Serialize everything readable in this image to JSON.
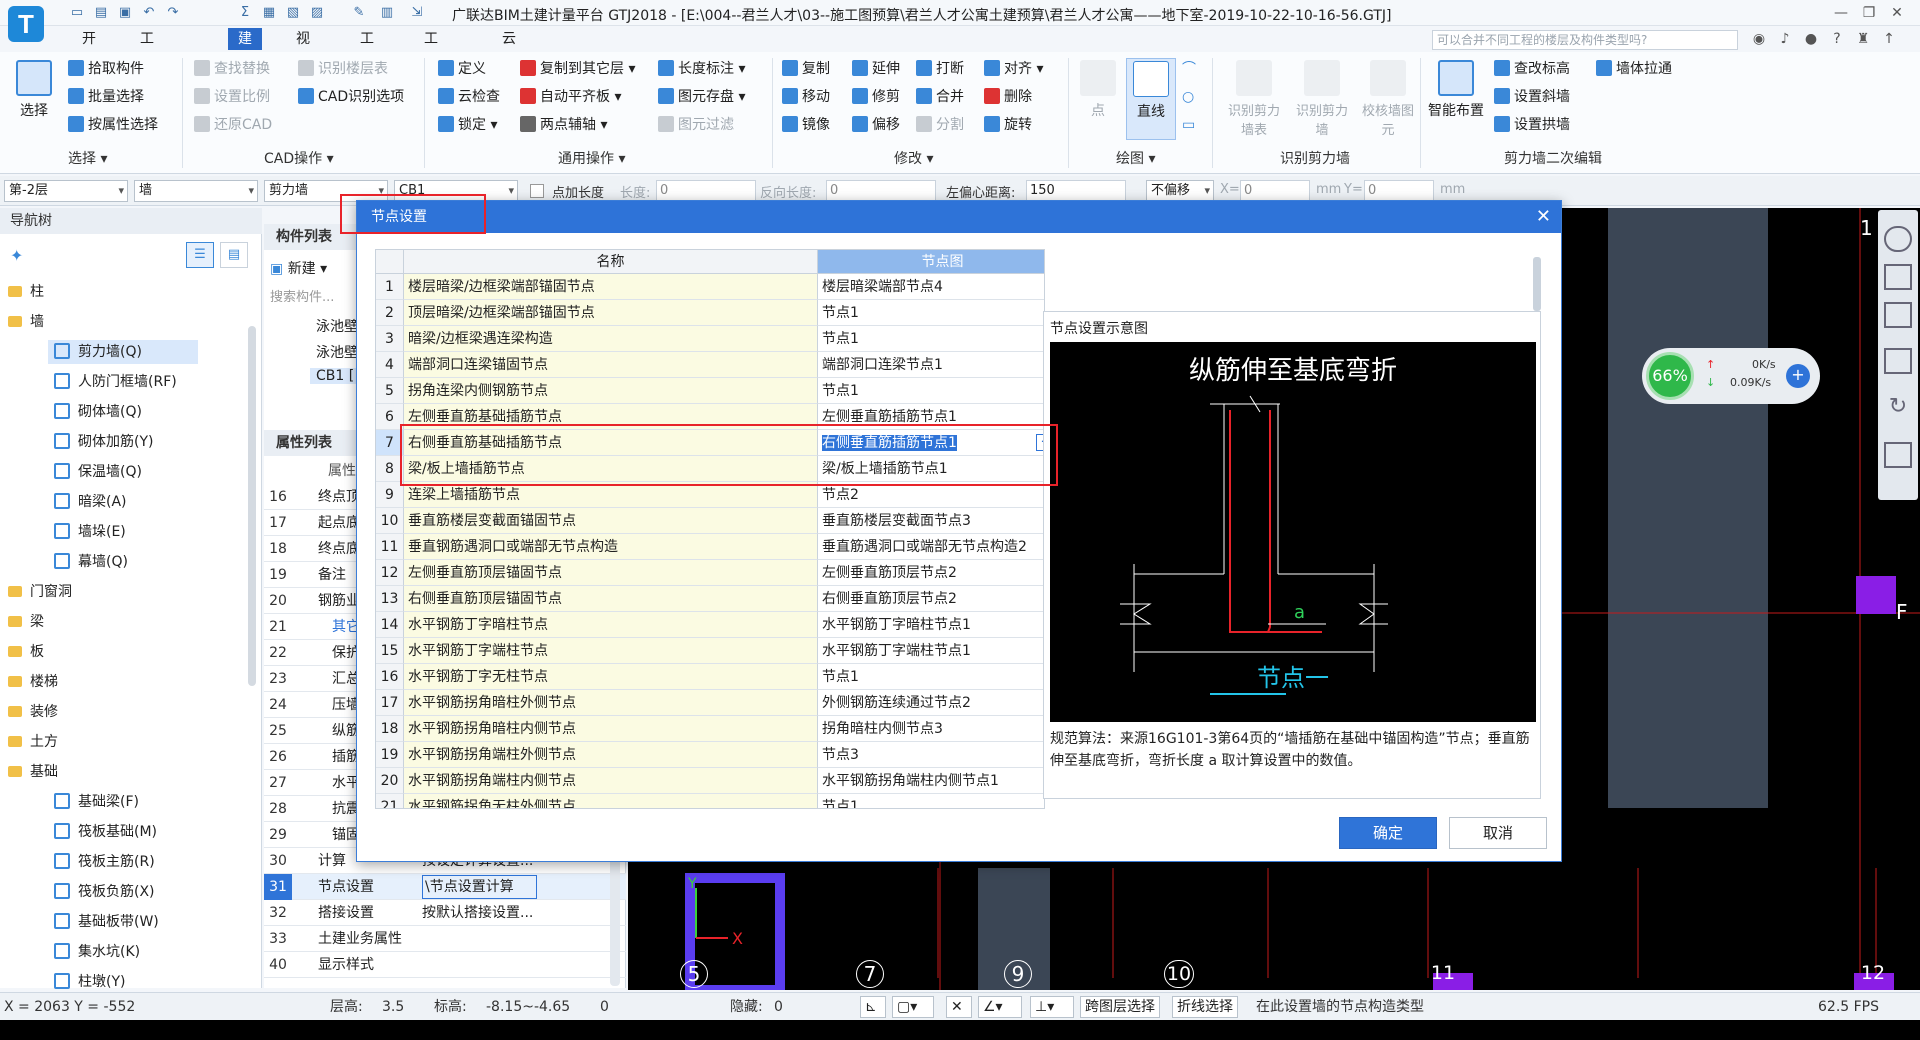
{
  "app": {
    "title": "广联达BIM土建计量平台 GTJ2018 - [E:\\004--君兰人才\\03--施工图预算\\君兰人才公寓土建预算\\君兰人才公寓——地下室-2019-10-22-10-16-56.GTJ]",
    "logo": "T",
    "help_search_placeholder": "可以合并不同工程的楼层及构件类型吗?"
  },
  "menu_tabs": [
    "开始",
    "工程设置",
    "建模",
    "视图",
    "工具",
    "工程量",
    "云应用"
  ],
  "ribbon": {
    "select_group": {
      "big": "选择",
      "items": [
        "拾取构件",
        "批量选择",
        "按属性选择"
      ],
      "label": "选择"
    },
    "cad_group": {
      "items": [
        "查找替换",
        "设置比例",
        "还原CAD",
        "识别楼层表",
        "CAD识别选项"
      ],
      "label": "CAD操作"
    },
    "general_group": {
      "items": [
        "定义",
        "云检查",
        "锁定",
        "复制到其它层",
        "自动平齐板",
        "两点辅轴",
        "长度标注",
        "图元存盘",
        "图元过滤"
      ],
      "label": "通用操作"
    },
    "modify_group": {
      "items": [
        "复制",
        "移动",
        "镜像",
        "延伸",
        "修剪",
        "偏移",
        "打断",
        "合并",
        "分割",
        "对齐",
        "删除",
        "旋转"
      ],
      "label": "修改"
    },
    "draw_group": {
      "items": [
        "点",
        "直线"
      ],
      "label": "绘图"
    },
    "recog_group": {
      "items": [
        "识别剪力墙表",
        "识别剪力墙",
        "校核墙图元"
      ],
      "label": "识别剪力墙"
    },
    "edit2_group": {
      "big": "智能布置",
      "items": [
        "查改标高",
        "墙体拉通",
        "设置斜墙",
        "设置拱墙"
      ],
      "label": "剪力墙二次编辑"
    }
  },
  "propbar": {
    "floor": "第-2层",
    "category": "墙",
    "type": "剪力墙",
    "component": "CB1",
    "pt_length_label": "点加长度",
    "length_label": "长度:",
    "length_value": "0",
    "rev_length_label": "反向长度:",
    "rev_length_value": "0",
    "left_offset_label": "左偏心距离:",
    "left_offset_value": "150",
    "offset_mode": "不偏移",
    "x_label": "X=",
    "x_value": "0",
    "mm1": "mm",
    "y_label": "Y=",
    "y_value": "0",
    "mm2": "mm"
  },
  "nav": {
    "header": "导航树",
    "items": [
      {
        "label": "柱",
        "type": "folder"
      },
      {
        "label": "墙",
        "type": "folder"
      },
      {
        "label": "剪力墙(Q)",
        "type": "leaf",
        "selected": true
      },
      {
        "label": "人防门框墙(RF)",
        "type": "leaf"
      },
      {
        "label": "砌体墙(Q)",
        "type": "leaf"
      },
      {
        "label": "砌体加筋(Y)",
        "type": "leaf"
      },
      {
        "label": "保温墙(Q)",
        "type": "leaf"
      },
      {
        "label": "暗梁(A)",
        "type": "leaf"
      },
      {
        "label": "墙垛(E)",
        "type": "leaf"
      },
      {
        "label": "幕墙(Q)",
        "type": "leaf"
      },
      {
        "label": "门窗洞",
        "type": "folder"
      },
      {
        "label": "梁",
        "type": "folder"
      },
      {
        "label": "板",
        "type": "folder"
      },
      {
        "label": "楼梯",
        "type": "folder"
      },
      {
        "label": "装修",
        "type": "folder"
      },
      {
        "label": "土方",
        "type": "folder"
      },
      {
        "label": "基础",
        "type": "folder"
      },
      {
        "label": "基础梁(F)",
        "type": "leaf"
      },
      {
        "label": "筏板基础(M)",
        "type": "leaf"
      },
      {
        "label": "筏板主筋(R)",
        "type": "leaf"
      },
      {
        "label": "筏板负筋(X)",
        "type": "leaf"
      },
      {
        "label": "基础板带(W)",
        "type": "leaf"
      },
      {
        "label": "集水坑(K)",
        "type": "leaf"
      },
      {
        "label": "柱墩(Y)",
        "type": "leaf"
      }
    ]
  },
  "complist": {
    "header": "构件列表",
    "new_label": "新建",
    "search_placeholder": "搜索构件...",
    "items": [
      "泳池壁",
      "泳池壁",
      "CB1 ["
    ],
    "prop_header": "属性列表",
    "prop_col": "属性",
    "props": [
      {
        "n": "16",
        "name": "终点顶标",
        "val": ""
      },
      {
        "n": "17",
        "name": "起点底标",
        "val": ""
      },
      {
        "n": "18",
        "name": "终点底标",
        "val": ""
      },
      {
        "n": "19",
        "name": "备注",
        "val": ""
      },
      {
        "n": "20",
        "name": "钢筋业",
        "val": ""
      },
      {
        "n": "21",
        "name": "其它",
        "val": ""
      },
      {
        "n": "22",
        "name": "保护",
        "val": ""
      },
      {
        "n": "23",
        "name": "汇总",
        "val": ""
      },
      {
        "n": "24",
        "name": "压墙",
        "val": ""
      },
      {
        "n": "25",
        "name": "纵筋",
        "val": ""
      },
      {
        "n": "26",
        "name": "插筋",
        "val": ""
      },
      {
        "n": "27",
        "name": "水平",
        "val": ""
      },
      {
        "n": "28",
        "name": "抗震",
        "val": ""
      },
      {
        "n": "29",
        "name": "锚固",
        "val": ""
      },
      {
        "n": "30",
        "name": "计算",
        "val": "按设定计算设置..."
      },
      {
        "n": "31",
        "name": "节点设置",
        "val": "\\节点设置计算"
      },
      {
        "n": "32",
        "name": "搭接设置",
        "val": "按默认搭接设置..."
      },
      {
        "n": "33",
        "name": "土建业务属性",
        "val": ""
      },
      {
        "n": "40",
        "name": "显示样式",
        "val": ""
      }
    ]
  },
  "canvas": {
    "axes": [
      "5",
      "7",
      "9",
      "10",
      "11",
      "12",
      "1",
      "F"
    ],
    "perf_percent": "66%",
    "up_speed": "0K/s",
    "down_speed": "0.09K/s"
  },
  "dialog": {
    "title": "节点设置",
    "col_name": "名称",
    "col_node": "节点图",
    "rows": [
      {
        "n": "1",
        "name": "楼层暗梁/边框梁端部锚固节点",
        "val": "楼层暗梁端部节点4"
      },
      {
        "n": "2",
        "name": "顶层暗梁/边框梁端部锚固节点",
        "val": "节点1"
      },
      {
        "n": "3",
        "name": "暗梁/边框梁遇连梁构造",
        "val": "节点1"
      },
      {
        "n": "4",
        "name": "端部洞口连梁锚固节点",
        "val": "端部洞口连梁节点1"
      },
      {
        "n": "5",
        "name": "拐角连梁内侧钢筋节点",
        "val": "节点1"
      },
      {
        "n": "6",
        "name": "左侧垂直筋基础插筋节点",
        "val": "左侧垂直筋插筋节点1"
      },
      {
        "n": "7",
        "name": "右侧垂直筋基础插筋节点",
        "val": "右侧垂直筋插筋节点1",
        "selected": true
      },
      {
        "n": "8",
        "name": "梁/板上墙插筋节点",
        "val": "梁/板上墙插筋节点1"
      },
      {
        "n": "9",
        "name": "连梁上墙插筋节点",
        "val": "节点2"
      },
      {
        "n": "10",
        "name": "垂直筋楼层变截面锚固节点",
        "val": "垂直筋楼层变截面节点3"
      },
      {
        "n": "11",
        "name": "垂直钢筋遇洞口或端部无节点构造",
        "val": "垂直筋遇洞口或端部无节点构造2"
      },
      {
        "n": "12",
        "name": "左侧垂直筋顶层锚固节点",
        "val": "左侧垂直筋顶层节点2"
      },
      {
        "n": "13",
        "name": "右侧垂直筋顶层锚固节点",
        "val": "右侧垂直筋顶层节点2"
      },
      {
        "n": "14",
        "name": "水平钢筋丁字暗柱节点",
        "val": "水平钢筋丁字暗柱节点1"
      },
      {
        "n": "15",
        "name": "水平钢筋丁字端柱节点",
        "val": "水平钢筋丁字端柱节点1"
      },
      {
        "n": "16",
        "name": "水平钢筋丁字无柱节点",
        "val": "节点1"
      },
      {
        "n": "17",
        "name": "水平钢筋拐角暗柱外侧节点",
        "val": "外侧钢筋连续通过节点2"
      },
      {
        "n": "18",
        "name": "水平钢筋拐角暗柱内侧节点",
        "val": "拐角暗柱内侧节点3"
      },
      {
        "n": "19",
        "name": "水平钢筋拐角端柱外侧节点",
        "val": "节点3"
      },
      {
        "n": "20",
        "name": "水平钢筋拐角端柱内侧节点",
        "val": "水平钢筋拐角端柱内侧节点1"
      },
      {
        "n": "21",
        "name": "水平钢筋拐角无柱外侧节点",
        "val": "节点1"
      }
    ],
    "preview_label": "节点设置示意图",
    "preview_title": "纵筋伸至基底弯折",
    "preview_dim": "a",
    "preview_caption": "节点一",
    "desc": "规范算法：来源16G101-3第64页的“墙插筋在基础中锚固构造”节点；垂直筋伸至基底弯折，弯折长度 a 取计算设置中的数值。",
    "ok_label": "确定",
    "cancel_label": "取消"
  },
  "status": {
    "coords": "X = 2063 Y = -552",
    "floor_height_label": "层高:",
    "floor_height": "3.5",
    "elev_label": "标高:",
    "elev": "-8.15~-4.65",
    "zero": "0",
    "hidden_label": "隐藏:",
    "hidden": "0",
    "cross_floor": "跨图层选择",
    "polyline": "折线选择",
    "hint": "在此设置墙的节点构造类型",
    "fps": "62.5 FPS"
  },
  "colors": {
    "accent": "#2e73d8",
    "highlight": "#e8232a",
    "grid_name_bg": "#fbfbe2"
  }
}
